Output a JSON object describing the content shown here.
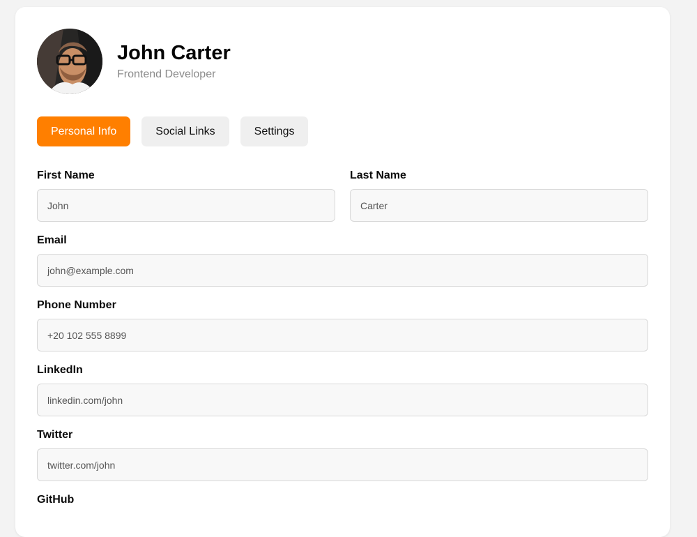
{
  "profile": {
    "name": "John Carter",
    "role": "Frontend Developer"
  },
  "tabs": [
    {
      "label": "Personal Info",
      "active": true
    },
    {
      "label": "Social Links",
      "active": false
    },
    {
      "label": "Settings",
      "active": false
    }
  ],
  "form": {
    "first_name": {
      "label": "First Name",
      "value": "John"
    },
    "last_name": {
      "label": "Last Name",
      "value": "Carter"
    },
    "email": {
      "label": "Email",
      "value": "john@example.com"
    },
    "phone": {
      "label": "Phone Number",
      "value": "+20 102 555 8899"
    },
    "linkedin": {
      "label": "LinkedIn",
      "value": "linkedin.com/john"
    },
    "twitter": {
      "label": "Twitter",
      "value": "twitter.com/john"
    },
    "github": {
      "label": "GitHub"
    }
  },
  "colors": {
    "accent": "#ff7f00",
    "page_background": "#f3f3f3",
    "card_background": "#ffffff",
    "input_background": "#f8f8f8"
  },
  "icons": {
    "avatar": "profile-photo"
  }
}
